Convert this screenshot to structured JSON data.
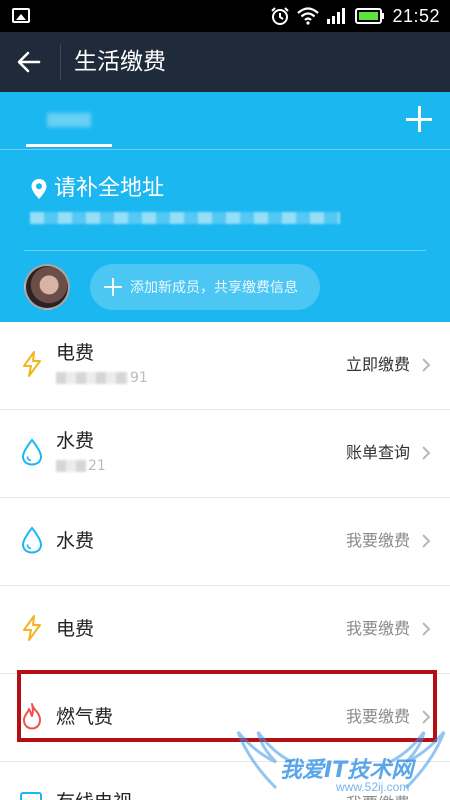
{
  "status_bar": {
    "time": "21:52",
    "icons": [
      "image-icon",
      "alarm-icon",
      "wifi-icon",
      "signal-icon",
      "battery-icon"
    ]
  },
  "header": {
    "title": "生活缴费"
  },
  "panel": {
    "tab_label": "广东",
    "address": "请补全地址",
    "add_member_label": "添加新成员，共享缴费信息"
  },
  "list": {
    "items": [
      {
        "name": "电费",
        "sub": "91",
        "action": "立即缴费",
        "icon": "lightning-icon"
      },
      {
        "name": "水费",
        "sub": "21",
        "action": "账单查询",
        "icon": "water-drop-icon"
      },
      {
        "name": "水费",
        "sub": "",
        "action": "我要缴费",
        "icon": "water-drop-icon"
      },
      {
        "name": "电费",
        "sub": "",
        "action": "我要缴费",
        "icon": "lightning-icon"
      },
      {
        "name": "燃气费",
        "sub": "",
        "action": "我要缴费",
        "icon": "flame-icon"
      }
    ],
    "partial_item": {
      "name": "有线电视",
      "action": "我要缴费",
      "icon": "tv-icon"
    }
  },
  "watermark": {
    "text": "我爱IT技术网",
    "url": "www.52ij.com"
  },
  "colors": {
    "accent": "#1ab7f0",
    "title_bar": "#1f2b3a",
    "highlight": "#b30f15",
    "lightning": "#f2b51c",
    "water": "#1ab7f0",
    "flame": "#f0514f"
  }
}
